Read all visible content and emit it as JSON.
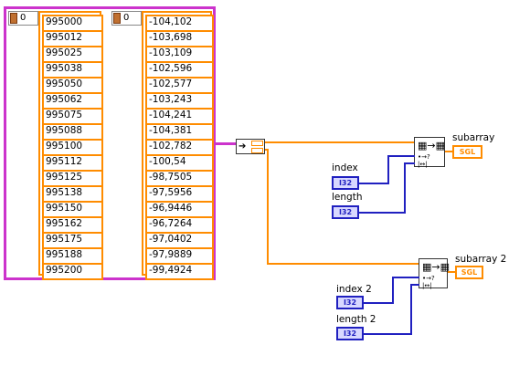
{
  "cluster": {
    "index_left": "0",
    "index_right": "0",
    "integers": [
      "995000",
      "995012",
      "995025",
      "995038",
      "995050",
      "995062",
      "995075",
      "995088",
      "995100",
      "995112",
      "995125",
      "995138",
      "995150",
      "995162",
      "995175",
      "995188",
      "995200"
    ],
    "decimals": [
      "-104,102",
      "-103,698",
      "-103,109",
      "-102,596",
      "-102,577",
      "-103,243",
      "-104,241",
      "-104,381",
      "-102,782",
      "-100,54",
      "-98,7505",
      "-97,5956",
      "-96,9446",
      "-96,7264",
      "-97,0402",
      "-97,9889",
      "-99,4924"
    ]
  },
  "block1": {
    "out_label": "subarray",
    "out_type": "SGL",
    "index_label": "index",
    "index_type": "I32",
    "length_label": "length",
    "length_type": "I32"
  },
  "block2": {
    "out_label": "subarray 2",
    "out_type": "SGL",
    "index_label": "index 2",
    "index_type": "I32",
    "length_label": "length 2",
    "length_type": "I32"
  },
  "colors": {
    "wire_numeric": "#ff8c00",
    "wire_cluster": "#cc33cc",
    "wire_i32": "#2020c0"
  }
}
